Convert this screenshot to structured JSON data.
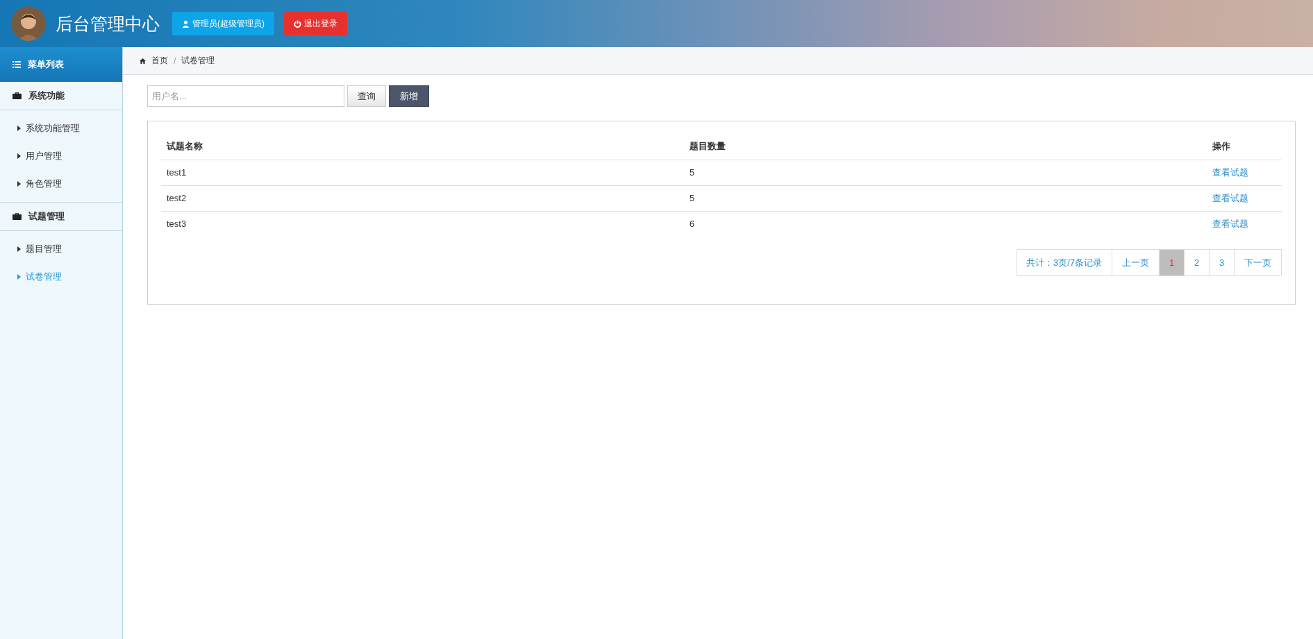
{
  "header": {
    "title": "后台管理中心",
    "user_button": "管理员(超级管理员)",
    "logout_button": "退出登录"
  },
  "sidebar": {
    "title": "菜单列表",
    "groups": [
      {
        "label": "系统功能",
        "items": [
          {
            "label": "系统功能管理",
            "selected": false
          },
          {
            "label": "用户管理",
            "selected": false
          },
          {
            "label": "角色管理",
            "selected": false
          }
        ]
      },
      {
        "label": "试题管理",
        "items": [
          {
            "label": "题目管理",
            "selected": false
          },
          {
            "label": "试卷管理",
            "selected": true
          }
        ]
      }
    ]
  },
  "breadcrumb": [
    "首页",
    "试卷管理"
  ],
  "breadcrumb_separator": "/",
  "search": {
    "placeholder": "用户名...",
    "buttons": [
      {
        "label": "查询",
        "kind": "plain"
      },
      {
        "label": "新增",
        "kind": "dark"
      }
    ]
  },
  "table": {
    "columns": [
      "试题名称",
      "题目数量",
      "操作"
    ],
    "rows": [
      {
        "name": "test1",
        "count": "5",
        "action": "查看试题"
      },
      {
        "name": "test2",
        "count": "5",
        "action": "查看试题"
      },
      {
        "name": "test3",
        "count": "6",
        "action": "查看试题"
      }
    ]
  },
  "pagination": {
    "summary": "共计：3页/7条记录",
    "prev": "上一页",
    "pages": [
      {
        "label": "1",
        "selected": true
      },
      {
        "label": "2",
        "selected": false
      },
      {
        "label": "3",
        "selected": false
      }
    ],
    "next": "下一页"
  }
}
